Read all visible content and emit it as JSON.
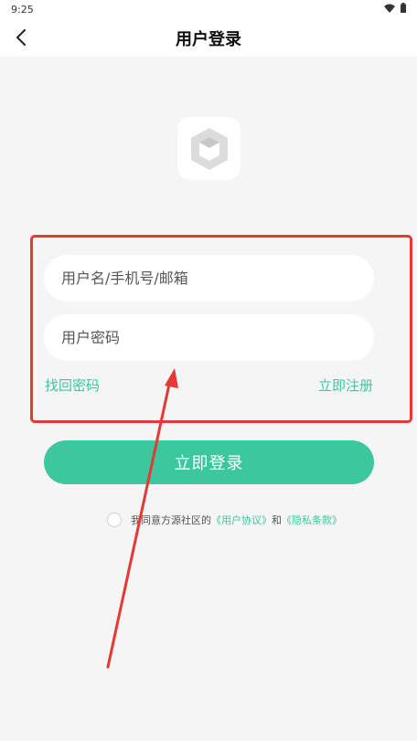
{
  "status_bar": {
    "time": "9:25"
  },
  "header": {
    "title": "用户登录",
    "back_icon": "chevron-left-icon"
  },
  "logo": {
    "icon": "cube-icon"
  },
  "form": {
    "username_placeholder": "用户名/手机号/邮箱",
    "password_placeholder": "用户密码",
    "forgot_password_label": "找回密码",
    "register_label": "立即注册",
    "login_button_label": "立即登录"
  },
  "agreement": {
    "prefix": "我同意方源社区的",
    "user_agreement": "《用户协议》",
    "connector": "和",
    "privacy_policy": "《隐私条款》"
  },
  "colors": {
    "accent": "#3cc79e",
    "annotation": "#e53935",
    "background": "#f5f5f5"
  }
}
